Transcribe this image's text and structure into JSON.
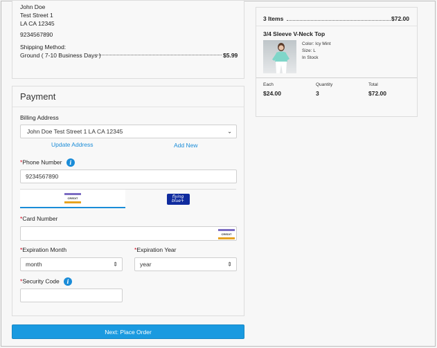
{
  "shipping_address": {
    "name": "John Doe",
    "street": "Test Street 1",
    "city_line": "LA CA 12345",
    "phone": "9234567890",
    "method_label": "Shipping Method:",
    "method": "Ground ( 7-10 Business Days )",
    "price": "$5.99"
  },
  "payment": {
    "title": "Payment",
    "billing_label": "Billing Address",
    "billing_selected": "John Doe Test Street 1 LA CA 12345",
    "update_address": "Update Address",
    "add_new": "Add New",
    "phone_label": "Phone Number",
    "phone_value": "9234567890",
    "tabs": [
      {
        "name": "credit-card",
        "icon_text": "CREDIT"
      },
      {
        "name": "flying-blue",
        "icon_text_1": "flying",
        "icon_text_2": "blue+"
      }
    ],
    "card_number_label": "Card Number",
    "card_icon_text": "CREDIT",
    "exp_month_label": "Expiration Month",
    "exp_month_value": "month",
    "exp_year_label": "Expiration Year",
    "exp_year_value": "year",
    "security_label": "Security Code",
    "required_mark": "*",
    "info_glyph": "i"
  },
  "next_button": "Next: Place Order",
  "summary": {
    "items_label": "3 Items",
    "items_total": "$72.00",
    "product_name": "3/4 Sleeve V-Neck Top",
    "color": "Color: Icy Mint",
    "size": "Size: L",
    "stock": "In Stock",
    "each_label": "Each",
    "each_value": "$24.00",
    "qty_label": "Quantity",
    "qty_value": "3",
    "total_label": "Total",
    "total_value": "$72.00"
  },
  "colors": {
    "accent": "#1a8cd8",
    "button": "#1a9ae0",
    "required": "#d0021b",
    "credit_top": "#7b6cc2",
    "credit_bottom": "#e7a321",
    "flying_blue": "#0f2b9e"
  }
}
